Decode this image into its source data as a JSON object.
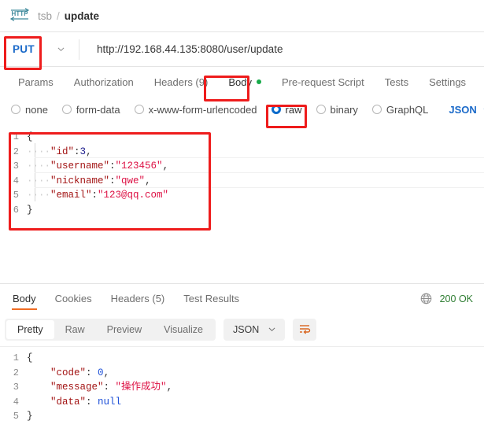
{
  "breadcrumb": {
    "protocol_icon": "http-icon",
    "collection": "tsb",
    "separator": "/",
    "request_name": "update"
  },
  "url_bar": {
    "method": "PUT",
    "method_caret_icon": "chevron-down-icon",
    "url": "http://192.168.44.135:8080/user/update"
  },
  "request_tabs": [
    {
      "label": "Params",
      "active": false
    },
    {
      "label": "Authorization",
      "active": false
    },
    {
      "label": "Headers (9)",
      "active": false
    },
    {
      "label": "Body",
      "active": true,
      "dot": true
    },
    {
      "label": "Pre-request Script",
      "active": false
    },
    {
      "label": "Tests",
      "active": false
    },
    {
      "label": "Settings",
      "active": false
    }
  ],
  "body_types": [
    {
      "label": "none",
      "selected": false
    },
    {
      "label": "form-data",
      "selected": false
    },
    {
      "label": "x-www-form-urlencoded",
      "selected": false
    },
    {
      "label": "raw",
      "selected": true
    },
    {
      "label": "binary",
      "selected": false
    },
    {
      "label": "GraphQL",
      "selected": false
    }
  ],
  "raw_format": {
    "label": "JSON",
    "caret_icon": "chevron-down-icon"
  },
  "request_body": {
    "lines": [
      {
        "num": "1",
        "text": "{"
      },
      {
        "num": "2",
        "text": "    \"id\":3,"
      },
      {
        "num": "3",
        "text": "    \"username\":\"123456\","
      },
      {
        "num": "4",
        "text": "    \"nickname\":\"qwe\","
      },
      {
        "num": "5",
        "text": "    \"email\":\"123@qq.com\""
      },
      {
        "num": "6",
        "text": "}"
      }
    ],
    "json": {
      "id": 3,
      "username": "123456",
      "nickname": "qwe",
      "email": "123@qq.com"
    }
  },
  "response_tabs": [
    {
      "label": "Body",
      "active": true
    },
    {
      "label": "Cookies",
      "active": false
    },
    {
      "label": "Headers (5)",
      "active": false
    },
    {
      "label": "Test Results",
      "active": false
    }
  ],
  "response_status": {
    "globe_icon": "globe-icon",
    "status": "200 OK",
    "status_color": "#2e7d32"
  },
  "response_toolbar": {
    "views": [
      {
        "label": "Pretty",
        "active": true
      },
      {
        "label": "Raw",
        "active": false
      },
      {
        "label": "Preview",
        "active": false
      },
      {
        "label": "Visualize",
        "active": false
      }
    ],
    "format": "JSON",
    "format_caret_icon": "chevron-down-icon",
    "wrap_icon": "word-wrap-icon"
  },
  "response_body": {
    "lines": [
      {
        "num": "1",
        "text": "{"
      },
      {
        "num": "2",
        "text": "    \"code\": 0,"
      },
      {
        "num": "3",
        "text": "    \"message\": \"操作成功\","
      },
      {
        "num": "4",
        "text": "    \"data\": null"
      },
      {
        "num": "5",
        "text": "}"
      }
    ],
    "json": {
      "code": 0,
      "message": "操作成功",
      "data": null
    }
  },
  "annotations": {
    "color": "#ee1c1c",
    "boxes": [
      {
        "name": "annotation-method",
        "target": "PUT"
      },
      {
        "name": "annotation-body-tab",
        "target": "Body"
      },
      {
        "name": "annotation-raw-radio",
        "target": "raw"
      },
      {
        "name": "annotation-request-body",
        "target": "request json editor"
      }
    ]
  }
}
